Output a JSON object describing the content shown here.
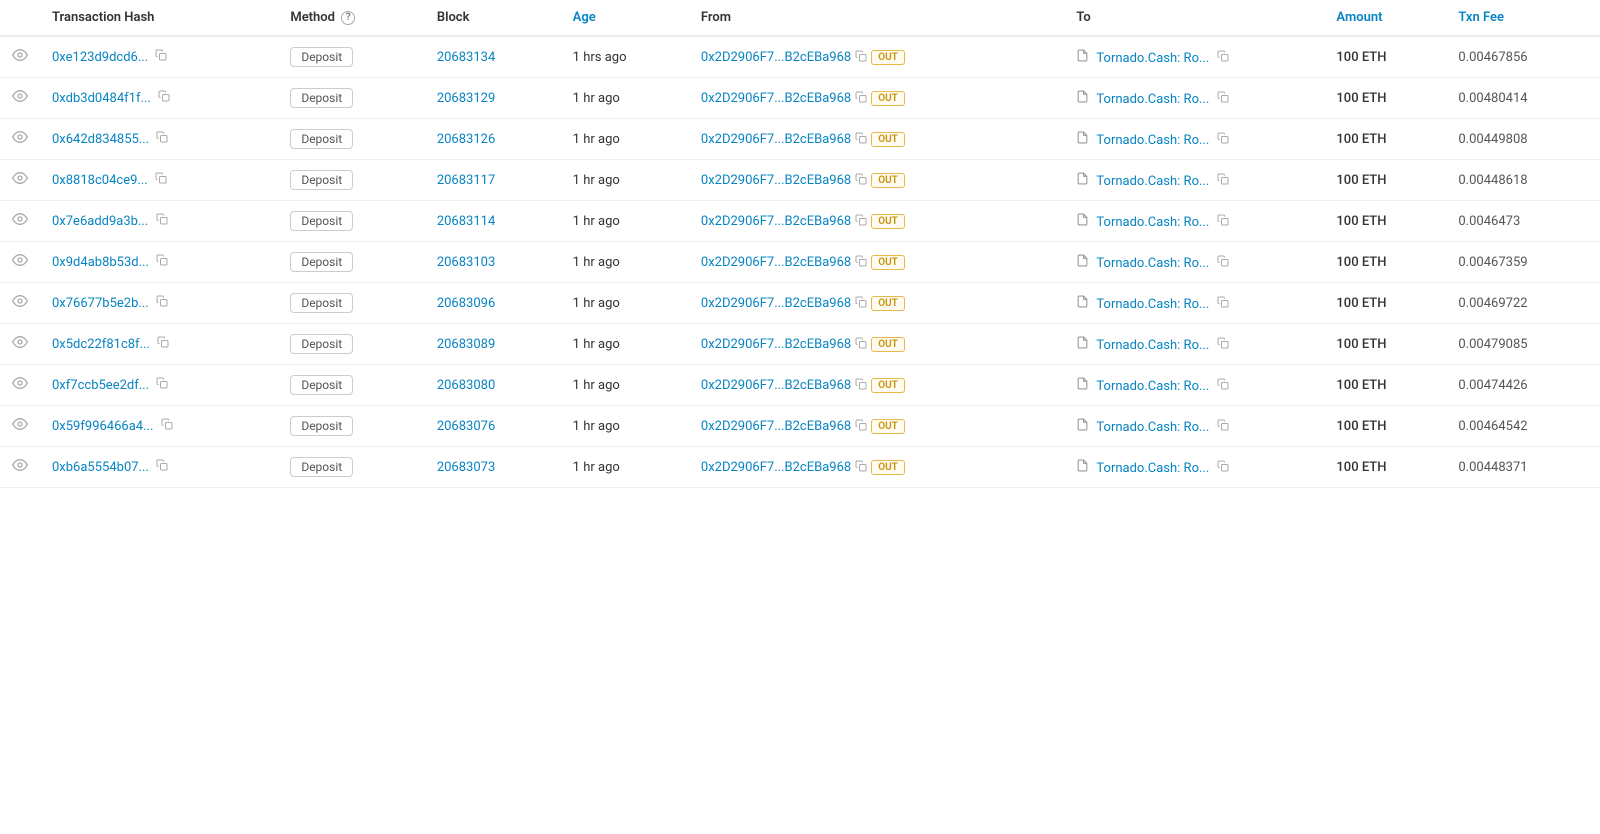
{
  "colors": {
    "link": "#0784c3",
    "out_badge_text": "#c8930a",
    "out_badge_border": "#e8b84b",
    "out_badge_bg": "#fffbf0"
  },
  "header": {
    "col_view": "",
    "col_tx_hash": "Transaction Hash",
    "col_method": "Method",
    "col_block": "Block",
    "col_age": "Age",
    "col_from": "From",
    "col_to": "To",
    "col_amount": "Amount",
    "col_txn_fee": "Txn Fee"
  },
  "rows": [
    {
      "tx_hash": "0xe123d9dcd6...",
      "method": "Deposit",
      "block": "20683134",
      "age": "1 hrs ago",
      "from": "0x2D2906F7...B2cEBa968",
      "direction": "OUT",
      "to": "Tornado.Cash: Ro...",
      "amount": "100 ETH",
      "txn_fee": "0.00467856"
    },
    {
      "tx_hash": "0xdb3d0484f1f...",
      "method": "Deposit",
      "block": "20683129",
      "age": "1 hr ago",
      "from": "0x2D2906F7...B2cEBa968",
      "direction": "OUT",
      "to": "Tornado.Cash: Ro...",
      "amount": "100 ETH",
      "txn_fee": "0.00480414"
    },
    {
      "tx_hash": "0x642d834855...",
      "method": "Deposit",
      "block": "20683126",
      "age": "1 hr ago",
      "from": "0x2D2906F7...B2cEBa968",
      "direction": "OUT",
      "to": "Tornado.Cash: Ro...",
      "amount": "100 ETH",
      "txn_fee": "0.00449808"
    },
    {
      "tx_hash": "0x8818c04ce9...",
      "method": "Deposit",
      "block": "20683117",
      "age": "1 hr ago",
      "from": "0x2D2906F7...B2cEBa968",
      "direction": "OUT",
      "to": "Tornado.Cash: Ro...",
      "amount": "100 ETH",
      "txn_fee": "0.00448618"
    },
    {
      "tx_hash": "0x7e6add9a3b...",
      "method": "Deposit",
      "block": "20683114",
      "age": "1 hr ago",
      "from": "0x2D2906F7...B2cEBa968",
      "direction": "OUT",
      "to": "Tornado.Cash: Ro...",
      "amount": "100 ETH",
      "txn_fee": "0.0046473"
    },
    {
      "tx_hash": "0x9d4ab8b53d...",
      "method": "Deposit",
      "block": "20683103",
      "age": "1 hr ago",
      "from": "0x2D2906F7...B2cEBa968",
      "direction": "OUT",
      "to": "Tornado.Cash: Ro...",
      "amount": "100 ETH",
      "txn_fee": "0.00467359"
    },
    {
      "tx_hash": "0x76677b5e2b...",
      "method": "Deposit",
      "block": "20683096",
      "age": "1 hr ago",
      "from": "0x2D2906F7...B2cEBa968",
      "direction": "OUT",
      "to": "Tornado.Cash: Ro...",
      "amount": "100 ETH",
      "txn_fee": "0.00469722"
    },
    {
      "tx_hash": "0x5dc22f81c8f...",
      "method": "Deposit",
      "block": "20683089",
      "age": "1 hr ago",
      "from": "0x2D2906F7...B2cEBa968",
      "direction": "OUT",
      "to": "Tornado.Cash: Ro...",
      "amount": "100 ETH",
      "txn_fee": "0.00479085"
    },
    {
      "tx_hash": "0xf7ccb5ee2df...",
      "method": "Deposit",
      "block": "20683080",
      "age": "1 hr ago",
      "from": "0x2D2906F7...B2cEBa968",
      "direction": "OUT",
      "to": "Tornado.Cash: Ro...",
      "amount": "100 ETH",
      "txn_fee": "0.00474426"
    },
    {
      "tx_hash": "0x59f996466a4...",
      "method": "Deposit",
      "block": "20683076",
      "age": "1 hr ago",
      "from": "0x2D2906F7...B2cEBa968",
      "direction": "OUT",
      "to": "Tornado.Cash: Ro...",
      "amount": "100 ETH",
      "txn_fee": "0.00464542"
    },
    {
      "tx_hash": "0xb6a5554b07...",
      "method": "Deposit",
      "block": "20683073",
      "age": "1 hr ago",
      "from": "0x2D2906F7...B2cEBa968",
      "direction": "OUT",
      "to": "Tornado.Cash: Ro...",
      "amount": "100 ETH",
      "txn_fee": "0.00448371"
    }
  ]
}
